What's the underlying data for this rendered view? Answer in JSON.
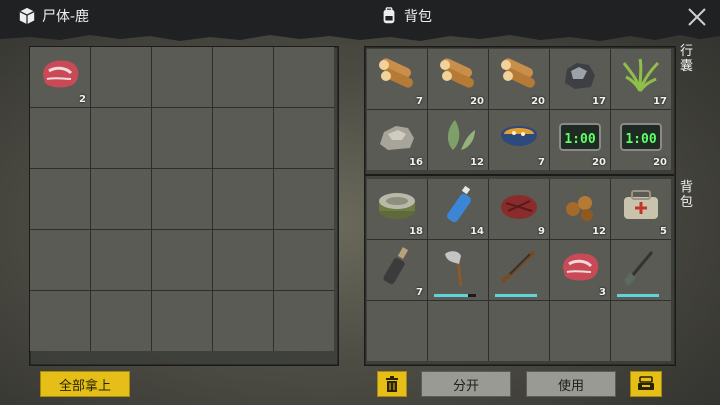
{
  "header": {
    "left_title": "尸体-鹿",
    "right_title": "背包"
  },
  "loot": [
    {
      "name": "raw-venison-meat",
      "qty": "2"
    }
  ],
  "pack_labels": {
    "satchel": "行囊",
    "backpack": "背包"
  },
  "satchel_items": [
    {
      "name": "log",
      "qty": "7"
    },
    {
      "name": "log",
      "qty": "20"
    },
    {
      "name": "log",
      "qty": "20"
    },
    {
      "name": "coal-ore",
      "qty": "17"
    },
    {
      "name": "grass-fiber",
      "qty": "17"
    },
    {
      "name": "stone",
      "qty": "16"
    },
    {
      "name": "green-leaf",
      "qty": "12"
    },
    {
      "name": "stew-pot",
      "qty": "7"
    },
    {
      "name": "digital-timer",
      "display": "1:00",
      "qty": "20"
    },
    {
      "name": "digital-timer",
      "display": "1:00",
      "qty": "20"
    }
  ],
  "backpack_items": [
    {
      "name": "canned-food",
      "qty": "18"
    },
    {
      "name": "water-bottle",
      "qty": "14"
    },
    {
      "name": "cooked-meat",
      "qty": "9"
    },
    {
      "name": "nuts",
      "qty": "12"
    },
    {
      "name": "first-aid-bag",
      "qty": "5"
    },
    {
      "name": "molotov-bottle",
      "qty": "7"
    },
    {
      "name": "axe",
      "durability": 0.8
    },
    {
      "name": "rifle",
      "durability": 1.0
    },
    {
      "name": "raw-meat",
      "qty": "3"
    },
    {
      "name": "shovel",
      "durability": 1.0
    }
  ],
  "buttons": {
    "take_all": "全部拿上",
    "split": "分开",
    "use": "使用"
  },
  "colors": {
    "accent_yellow": "#e5bf18",
    "durability": "#5fd5d9",
    "panel": "#3c3e3a"
  }
}
